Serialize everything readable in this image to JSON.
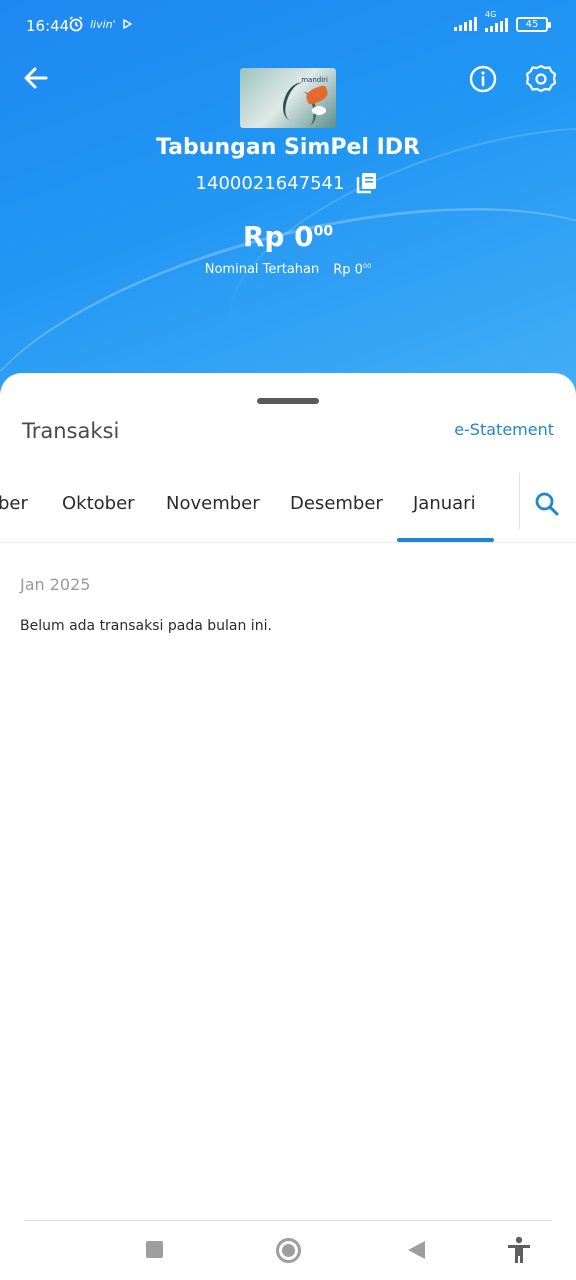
{
  "status_bar": {
    "time": "16:44",
    "network_label": "4G",
    "battery": "45"
  },
  "account": {
    "card_brand": "mandiri",
    "name": "Tabungan SimPel IDR",
    "number": "1400021647541",
    "balance_main": "Rp 0",
    "balance_decimal": "00",
    "hold_label": "Nominal Tertahan",
    "hold_main": "Rp 0",
    "hold_decimal": "00"
  },
  "sheet": {
    "title": "Transaksi",
    "estatement_label": "e-Statement",
    "tabs": [
      {
        "label": "ber"
      },
      {
        "label": "Oktober"
      },
      {
        "label": "November"
      },
      {
        "label": "Desember"
      },
      {
        "label": "Januari",
        "selected": true
      }
    ],
    "month_heading": "Jan 2025",
    "empty_message": "Belum ada transaksi pada bulan ini."
  },
  "colors": {
    "header_blue": "#2196f3",
    "accent": "#1f86d6",
    "text_dark": "#2b2b2b",
    "text_muted": "#9a9a9a"
  },
  "icons": {
    "back": "arrow-left-icon",
    "info": "info-icon",
    "settings": "gear-icon",
    "copy": "copy-icon",
    "search": "search-icon"
  }
}
